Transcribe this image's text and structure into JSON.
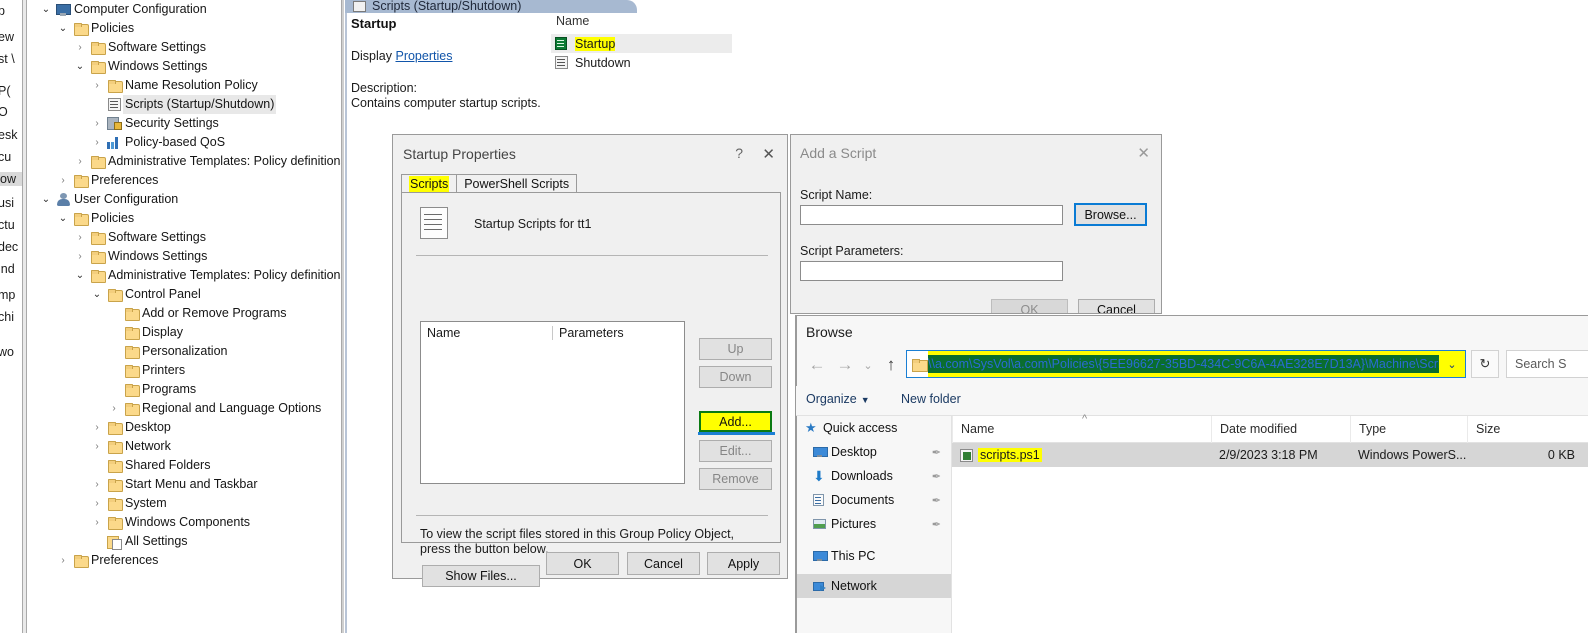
{
  "left_sliver": {
    "fragments": [
      "p",
      "ew",
      "st \\",
      "P(",
      "O",
      "esk",
      "cu",
      "ow",
      "usi",
      "ctu",
      "dec",
      "ind",
      "mp",
      "chi",
      "wo"
    ],
    "selected_index": 7
  },
  "tree": {
    "nodes": [
      {
        "label": "Computer Configuration",
        "indent": 0,
        "chev": "open",
        "icon": "computer-icon",
        "highlight": false
      },
      {
        "label": "Policies",
        "indent": 1,
        "chev": "open",
        "icon": "folder-icon",
        "highlight": false
      },
      {
        "label": "Software Settings",
        "indent": 2,
        "chev": "closed",
        "icon": "folder-icon",
        "highlight": false
      },
      {
        "label": "Windows Settings",
        "indent": 2,
        "chev": "open",
        "icon": "folder-icon",
        "highlight": false
      },
      {
        "label": "Name Resolution Policy",
        "indent": 3,
        "chev": "closed",
        "icon": "folder-icon",
        "highlight": false
      },
      {
        "label": "Scripts (Startup/Shutdown)",
        "indent": 3,
        "chev": "none",
        "icon": "script-icon",
        "highlight": true
      },
      {
        "label": "Security Settings",
        "indent": 3,
        "chev": "closed",
        "icon": "security-icon",
        "highlight": false
      },
      {
        "label": "Policy-based QoS",
        "indent": 3,
        "chev": "closed",
        "icon": "qos-icon",
        "highlight": false
      },
      {
        "label": "Administrative Templates: Policy definitions (/",
        "indent": 2,
        "chev": "closed",
        "icon": "folder-icon",
        "highlight": false
      },
      {
        "label": "Preferences",
        "indent": 1,
        "chev": "closed",
        "icon": "folder-icon",
        "highlight": false
      },
      {
        "label": "User Configuration",
        "indent": 0,
        "chev": "open",
        "icon": "user-icon",
        "highlight": false
      },
      {
        "label": "Policies",
        "indent": 1,
        "chev": "open",
        "icon": "folder-icon",
        "highlight": false
      },
      {
        "label": "Software Settings",
        "indent": 2,
        "chev": "closed",
        "icon": "folder-icon",
        "highlight": false
      },
      {
        "label": "Windows Settings",
        "indent": 2,
        "chev": "closed",
        "icon": "folder-icon",
        "highlight": false
      },
      {
        "label": "Administrative Templates: Policy definitions (/",
        "indent": 2,
        "chev": "open",
        "icon": "folder-icon",
        "highlight": false
      },
      {
        "label": "Control Panel",
        "indent": 3,
        "chev": "open",
        "icon": "folder-icon",
        "highlight": false
      },
      {
        "label": "Add or Remove Programs",
        "indent": 4,
        "chev": "none",
        "icon": "folder-icon",
        "highlight": false
      },
      {
        "label": "Display",
        "indent": 4,
        "chev": "none",
        "icon": "folder-icon",
        "highlight": false
      },
      {
        "label": "Personalization",
        "indent": 4,
        "chev": "none",
        "icon": "folder-icon",
        "highlight": false
      },
      {
        "label": "Printers",
        "indent": 4,
        "chev": "none",
        "icon": "folder-icon",
        "highlight": false
      },
      {
        "label": "Programs",
        "indent": 4,
        "chev": "none",
        "icon": "folder-icon",
        "highlight": false
      },
      {
        "label": "Regional and Language Options",
        "indent": 4,
        "chev": "closed",
        "icon": "folder-icon",
        "highlight": false
      },
      {
        "label": "Desktop",
        "indent": 3,
        "chev": "closed",
        "icon": "folder-icon",
        "highlight": false
      },
      {
        "label": "Network",
        "indent": 3,
        "chev": "closed",
        "icon": "folder-icon",
        "highlight": false
      },
      {
        "label": "Shared Folders",
        "indent": 3,
        "chev": "none",
        "icon": "folder-icon",
        "highlight": false
      },
      {
        "label": "Start Menu and Taskbar",
        "indent": 3,
        "chev": "closed",
        "icon": "folder-icon",
        "highlight": false
      },
      {
        "label": "System",
        "indent": 3,
        "chev": "closed",
        "icon": "folder-icon",
        "highlight": false
      },
      {
        "label": "Windows Components",
        "indent": 3,
        "chev": "closed",
        "icon": "folder-icon",
        "highlight": false
      },
      {
        "label": "All Settings",
        "indent": 3,
        "chev": "none",
        "icon": "all-settings-icon",
        "highlight": false
      },
      {
        "label": "Preferences",
        "indent": 1,
        "chev": "closed",
        "icon": "folder-icon",
        "highlight": false
      }
    ]
  },
  "results": {
    "header_title": "Scripts (Startup/Shutdown)",
    "extended_label": "Startup",
    "display_label": "Display",
    "properties_link": "Properties",
    "description_label": "Description:",
    "description_text": "Contains computer startup scripts.",
    "name_column": "Name",
    "items": [
      {
        "label": "Startup",
        "selected": true,
        "highlight": true
      },
      {
        "label": "Shutdown",
        "selected": false,
        "highlight": false
      }
    ]
  },
  "properties_dialog": {
    "title": "Startup Properties",
    "help_glyph": "?",
    "close_glyph": "✕",
    "tabs": [
      {
        "label": "Scripts",
        "active": true,
        "highlight": true
      },
      {
        "label": "PowerShell Scripts",
        "active": false,
        "highlight": false
      }
    ],
    "icon_title": "Startup Scripts for tt1",
    "list_headers": [
      "Name",
      "Parameters"
    ],
    "side_buttons": [
      {
        "label": "Up",
        "enabled": false
      },
      {
        "label": "Down",
        "enabled": false
      },
      {
        "label": "Add...",
        "enabled": true,
        "highlight": true
      },
      {
        "label": "Edit...",
        "enabled": false
      },
      {
        "label": "Remove",
        "enabled": false
      }
    ],
    "note_text": "To view the script files stored in this Group Policy Object, press the button below.",
    "show_files_label": "Show Files...",
    "ok_label": "OK",
    "cancel_label": "Cancel",
    "apply_label": "Apply"
  },
  "add_script_dialog": {
    "title": "Add a Script",
    "close_glyph": "✕",
    "script_name_label": "Script Name:",
    "script_name_value": "",
    "browse_label": "Browse...",
    "script_params_label": "Script Parameters:",
    "script_params_value": "",
    "ok_label": "OK",
    "cancel_label": "Cancel"
  },
  "browse_dialog": {
    "title": "Browse",
    "nav": {
      "back_glyph": "←",
      "forward_glyph": "→",
      "recent_glyph": "⌄",
      "up_glyph": "↑"
    },
    "address_value": "\\\\a.com\\SysVol\\a.com\\Policies\\{5EE96627-35BD-434C-9C6A-4AE328E7D13A}\\Machine\\Scripts\\Star",
    "address_chevron": "⌄",
    "refresh_glyph": "↻",
    "search_placeholder": "Search S",
    "organize_label": "Organize",
    "organize_caret": "▼",
    "new_folder_label": "New folder",
    "nav_items": [
      {
        "label": "Quick access",
        "icon": "star-icon",
        "pinned": false,
        "selected": false
      },
      {
        "label": "Desktop",
        "icon": "monitor-icon",
        "pinned": true,
        "selected": false
      },
      {
        "label": "Downloads",
        "icon": "download-arrow-icon",
        "pinned": true,
        "selected": false
      },
      {
        "label": "Documents",
        "icon": "document-icon",
        "pinned": true,
        "selected": false
      },
      {
        "label": "Pictures",
        "icon": "picture-icon",
        "pinned": true,
        "selected": false
      },
      {
        "label": "This PC",
        "icon": "this-pc-icon",
        "pinned": false,
        "selected": false
      },
      {
        "label": "Network",
        "icon": "network-icon",
        "pinned": false,
        "selected": true
      }
    ],
    "columns": [
      "Name",
      "Date modified",
      "Type",
      "Size"
    ],
    "sorted_column": "Name",
    "rows": [
      {
        "name": "scripts.ps1",
        "date_modified": "2/9/2023 3:18 PM",
        "type": "Windows PowerS...",
        "size": "0 KB",
        "selected": true,
        "highlight": true
      }
    ]
  },
  "pin_glyph": "📌"
}
